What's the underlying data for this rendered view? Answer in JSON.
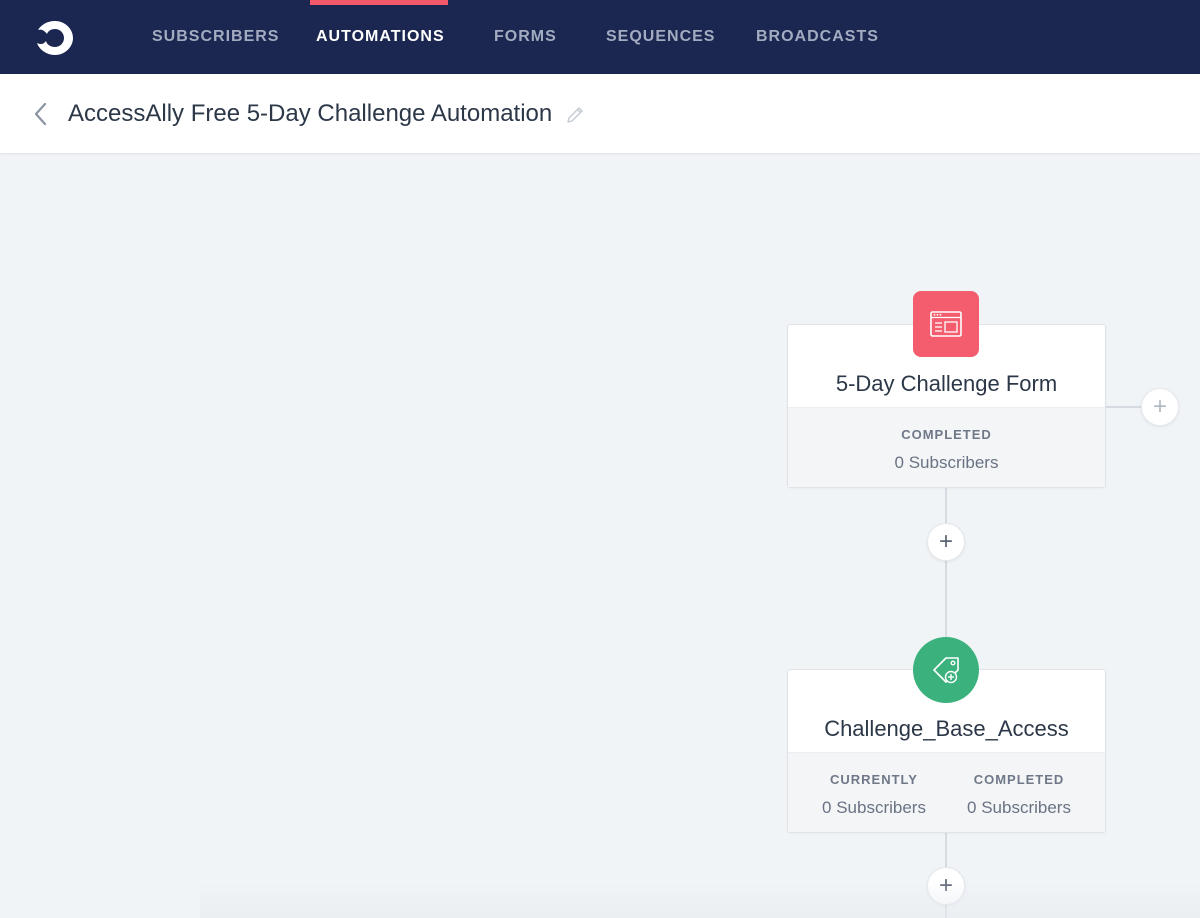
{
  "nav": {
    "items": [
      {
        "label": "SUBSCRIBERS"
      },
      {
        "label": "AUTOMATIONS"
      },
      {
        "label": "FORMS"
      },
      {
        "label": "SEQUENCES"
      },
      {
        "label": "BROADCASTS"
      }
    ],
    "active": "AUTOMATIONS",
    "accent_color": "#f1586a",
    "background": "#1b2751"
  },
  "header": {
    "title": "AccessAlly Free 5-Day Challenge Automation",
    "back_icon": "chevron-left-icon",
    "edit_icon": "pencil-icon"
  },
  "nodes": [
    {
      "type": "form",
      "icon": "form-icon",
      "icon_color": "#f35d6d",
      "title": "5-Day Challenge Form",
      "stats": [
        {
          "label": "COMPLETED",
          "value": "0 Subscribers"
        }
      ]
    },
    {
      "type": "tag",
      "icon": "tag-icon",
      "icon_color": "#3bb27d",
      "title": "Challenge_Base_Access",
      "stats": [
        {
          "label": "CURRENTLY",
          "value": "0 Subscribers"
        },
        {
          "label": "COMPLETED",
          "value": "0 Subscribers"
        }
      ]
    }
  ],
  "add_button_glyph": "+"
}
